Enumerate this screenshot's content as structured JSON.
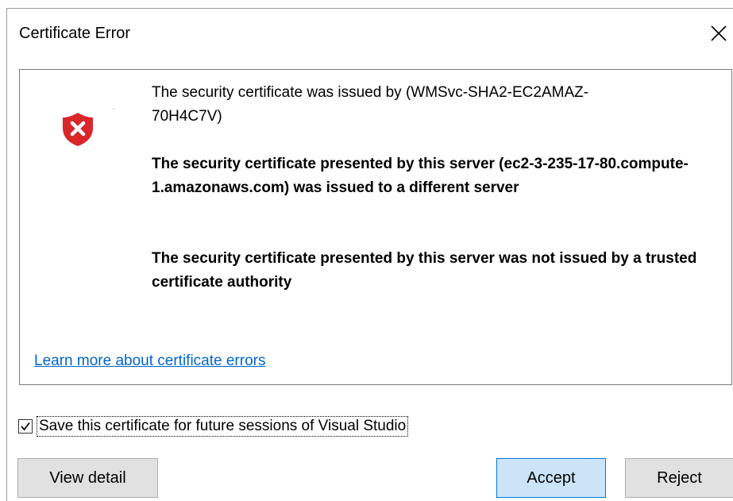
{
  "dialog": {
    "title": "Certificate Error"
  },
  "messages": {
    "issued_by": "The security certificate was issued by (WMSvc-SHA2-EC2AMAZ-70H4C7V)",
    "different_server": "The security certificate presented by this server (ec2-3-235-17-80.compute-1.amazonaws.com) was issued to a different server",
    "untrusted_authority": "The security certificate presented by this server was not issued by a trusted certificate authority"
  },
  "link": {
    "learn_more": "Learn more about certificate errors"
  },
  "save_option": {
    "label": "Save this certificate for future sessions of Visual Studio",
    "checked": true
  },
  "buttons": {
    "view_detail": "View detail",
    "accept": "Accept",
    "reject": "Reject"
  },
  "icons": {
    "error": "shield-error-icon",
    "close": "close-icon",
    "check": "check-icon"
  },
  "colors": {
    "error_red": "#d9262b",
    "link_blue": "#0066cc",
    "accept_bg": "#cce4f7",
    "accept_border": "#0078d7",
    "button_bg": "#e1e1e1"
  }
}
